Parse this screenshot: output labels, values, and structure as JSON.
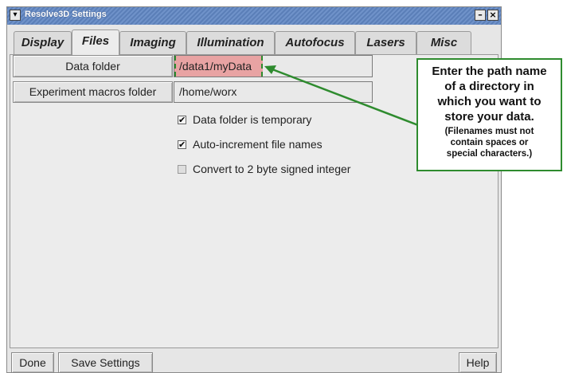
{
  "window": {
    "title": "Resolve3D Settings",
    "menu_glyph": "▾",
    "minimize_glyph": "–",
    "close_glyph": "×",
    "title_bar_color": "#5b7fb8"
  },
  "tabs": [
    {
      "label": "Display"
    },
    {
      "label": "Files",
      "active": true
    },
    {
      "label": "Imaging"
    },
    {
      "label": "Illumination"
    },
    {
      "label": "Autofocus"
    },
    {
      "label": "Lasers"
    },
    {
      "label": "Misc"
    }
  ],
  "files": {
    "data_folder_label": "Data folder",
    "data_folder_value": "/data1/myData",
    "macros_folder_label": "Experiment macros folder",
    "macros_folder_value": "/home/worx",
    "options": [
      {
        "label": "Data folder is temporary",
        "checked": true
      },
      {
        "label": "Auto-increment file names",
        "checked": true
      },
      {
        "label": "Convert to 2 byte signed integer",
        "checked": false
      }
    ]
  },
  "footer": {
    "done_label": "Done",
    "save_label": "Save Settings",
    "help_label": "Help"
  },
  "callout": {
    "main_text": "Enter the path name\nof a directory in\nwhich you want to\nstore your data.",
    "sub_text": "(Filenames must not\ncontain spaces or\nspecial characters.)",
    "border_color": "#2e8b2e",
    "highlight_color": "#e8a3a3"
  },
  "icons": {
    "check": "✔"
  }
}
